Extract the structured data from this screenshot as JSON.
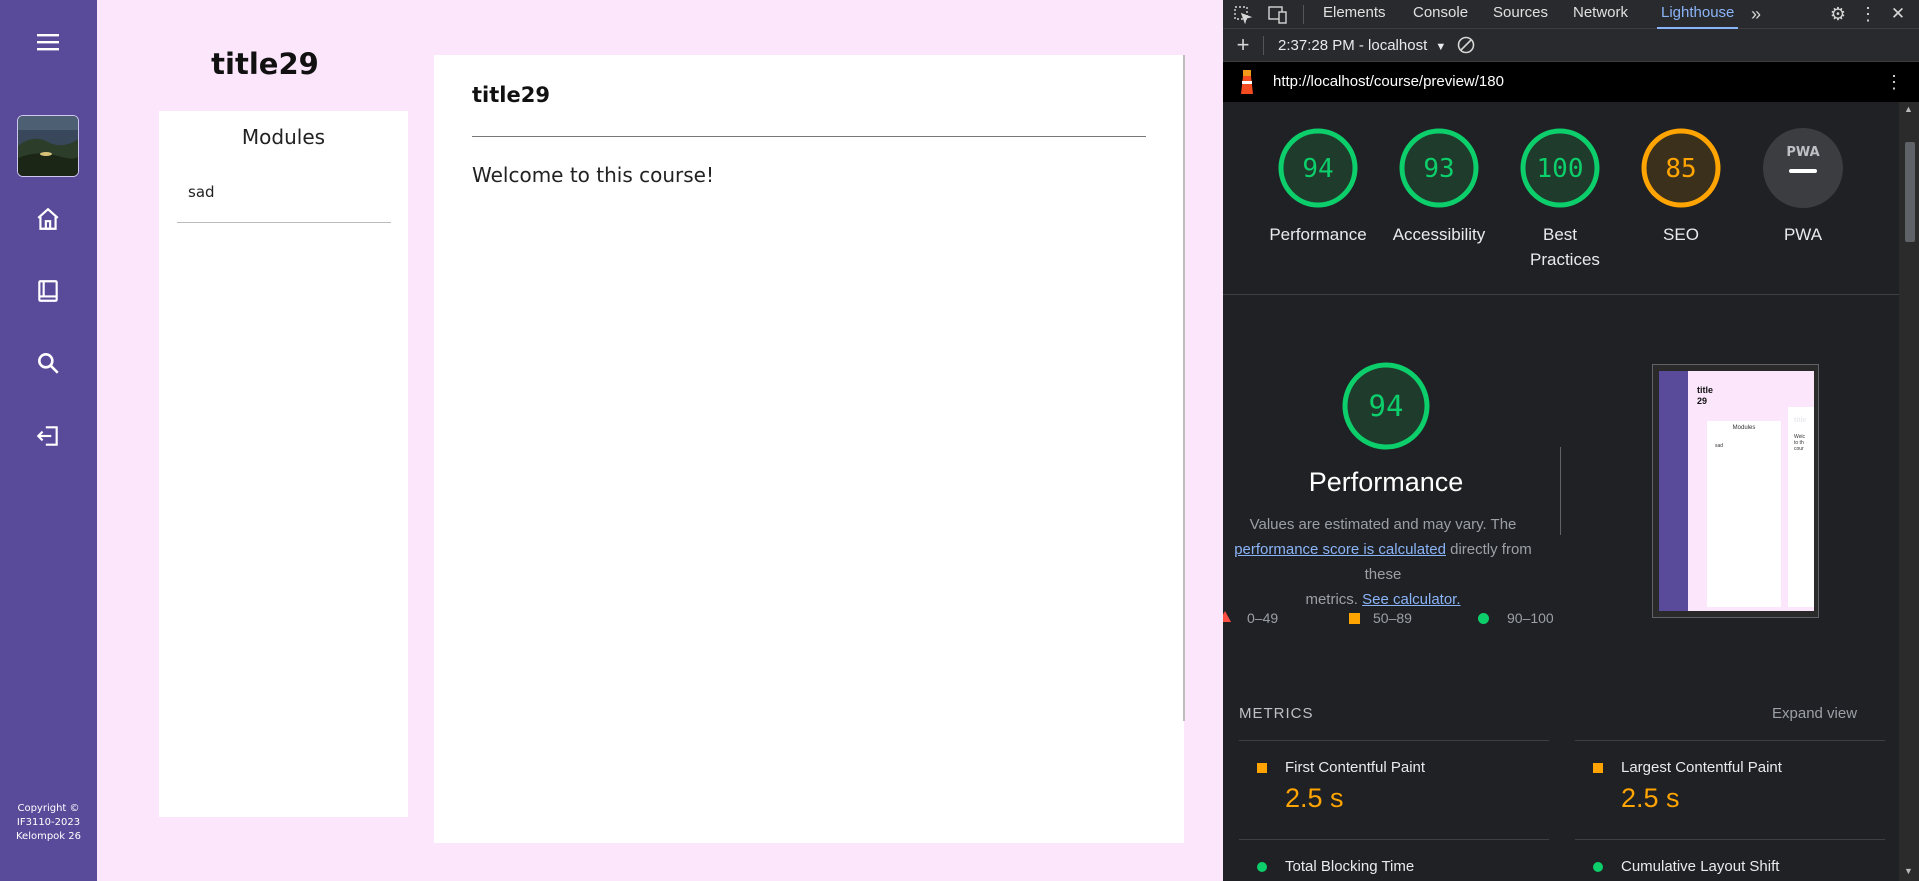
{
  "app": {
    "course_title": "title29",
    "modules_heading": "Modules",
    "modules": [
      {
        "label": "sad"
      }
    ],
    "content_title": "title29",
    "welcome_text": "Welcome to this course!",
    "copyright": "Copyright © IF3110-2023 Kelompok 26",
    "sidebar_icons": [
      "menu-icon",
      "course-thumbnail",
      "home-icon",
      "book-icon",
      "search-icon",
      "logout-icon"
    ]
  },
  "devtools": {
    "tabs": [
      "Elements",
      "Console",
      "Sources",
      "Network",
      "Lighthouse"
    ],
    "active_tab": "Lighthouse",
    "report_time": "2:37:28 PM - localhost",
    "url": "http://localhost/course/preview/180",
    "scores": [
      {
        "label": "Performance",
        "value": "94",
        "color": "#0cce6b"
      },
      {
        "label": "Accessibility",
        "value": "93",
        "color": "#0cce6b"
      },
      {
        "label": "Best Practices",
        "value": "100",
        "color": "#0cce6b"
      },
      {
        "label": "SEO",
        "value": "85",
        "color": "#ffa400"
      },
      {
        "label": "PWA",
        "value": "PWA",
        "color": "#9aa0a6"
      }
    ],
    "performance": {
      "score": "94",
      "title": "Performance",
      "desc_1": "Values are estimated and may vary. The",
      "desc_link": "performance score is calculated",
      "desc_2": "directly from these",
      "desc_3": "metrics.",
      "calc_link": "See calculator.",
      "legend": [
        "0–49",
        "50–89",
        "90–100"
      ]
    },
    "thumbnail": {
      "title": "title 29",
      "modules": "Modules",
      "item": "sad",
      "content": "title",
      "body": "Welc to th cour"
    },
    "metrics_heading": "METRICS",
    "expand_label": "Expand view",
    "metrics": [
      {
        "name": "First Contentful Paint",
        "value": "2.5 s",
        "status": "average"
      },
      {
        "name": "Largest Contentful Paint",
        "value": "2.5 s",
        "status": "average"
      },
      {
        "name": "Total Blocking Time",
        "value": "",
        "status": "pass"
      },
      {
        "name": "Cumulative Layout Shift",
        "value": "",
        "status": "pass"
      }
    ],
    "colors": {
      "pass": "#0cce6b",
      "average": "#ffa400",
      "fail": "#ff4e42",
      "link": "#8ab4f8"
    }
  }
}
